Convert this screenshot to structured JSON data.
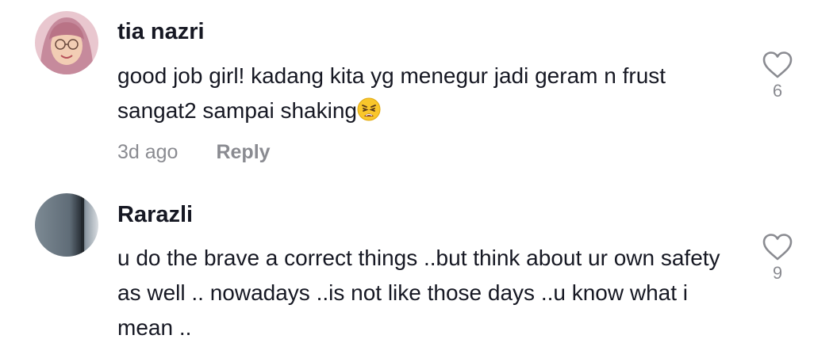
{
  "comments": [
    {
      "username": "tia nazri",
      "text": "good job girl! kadang kita yg menegur jadi geram n frust sangat2 sampai shaking",
      "emoji": "weary-face-emoji",
      "time": "3d ago",
      "reply_label": "Reply",
      "likes": "6",
      "avatar_icon": "profile-photo-hijab"
    },
    {
      "username": "Rarazli",
      "text": "u do the brave a correct things ..but think about ur own safety as well .. nowadays ..is not like those days ..u know what i mean ..",
      "likes": "9",
      "avatar_icon": "profile-photo-grey"
    }
  ],
  "colors": {
    "text_primary": "#161823",
    "text_secondary": "#8a8b91",
    "icon_grey": "#8a8b91"
  }
}
